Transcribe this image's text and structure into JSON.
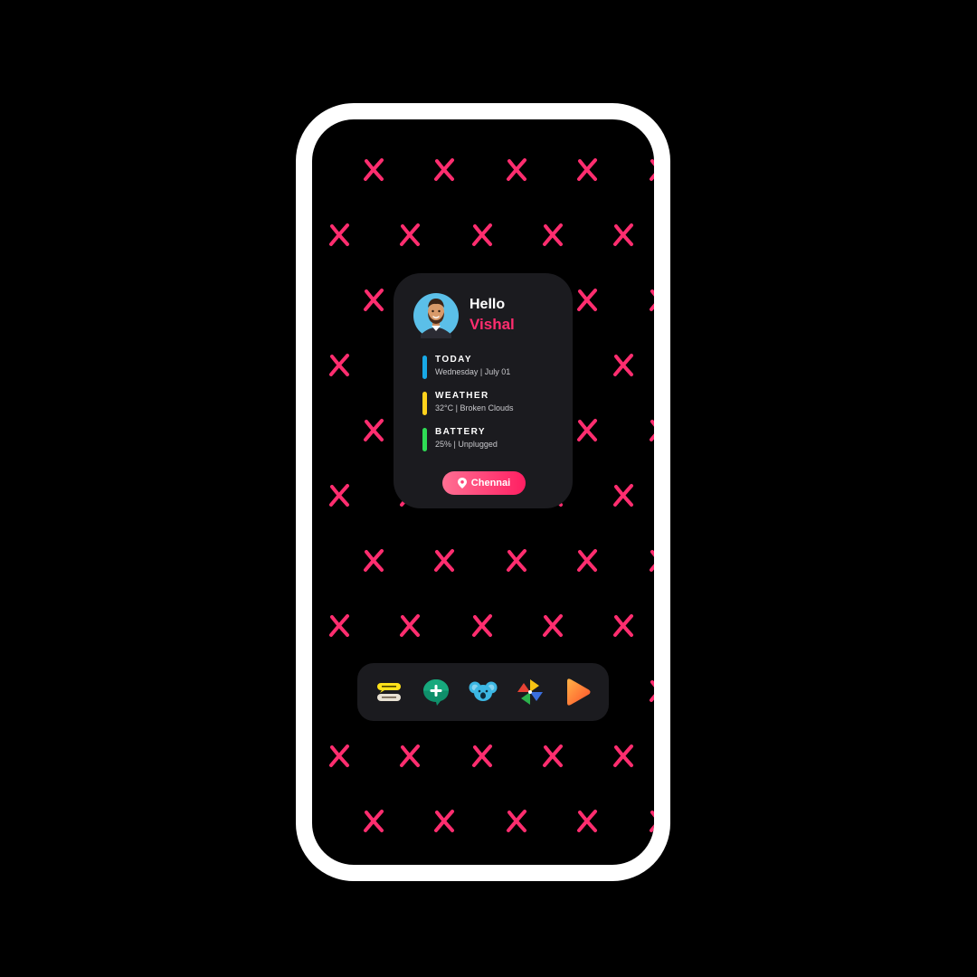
{
  "greeting": {
    "hello": "Hello",
    "name": "Vishal"
  },
  "info_rows": [
    {
      "title": "TODAY",
      "detail": "Wednesday  |  July 01",
      "accent": "#18a9e6"
    },
    {
      "title": "WEATHER",
      "detail": "32°C  |  Broken Clouds",
      "accent": "#ffd21c"
    },
    {
      "title": "BATTERY",
      "detail": "25%  |  Unplugged",
      "accent": "#2fdc55"
    }
  ],
  "location": {
    "label": "Chennai",
    "icon": "location-pin-icon"
  },
  "dock": {
    "apps": [
      {
        "icon": "chat-bubbles-icon"
      },
      {
        "icon": "add-message-icon"
      },
      {
        "icon": "koala-icon"
      },
      {
        "icon": "pinwheel-icon"
      },
      {
        "icon": "play-icon"
      }
    ]
  },
  "colors": {
    "accent": "#ff2d6f",
    "wallpaper_mark": "#ff2d6f",
    "card_background": "#1b1b1f",
    "frame": "#ffffff"
  }
}
